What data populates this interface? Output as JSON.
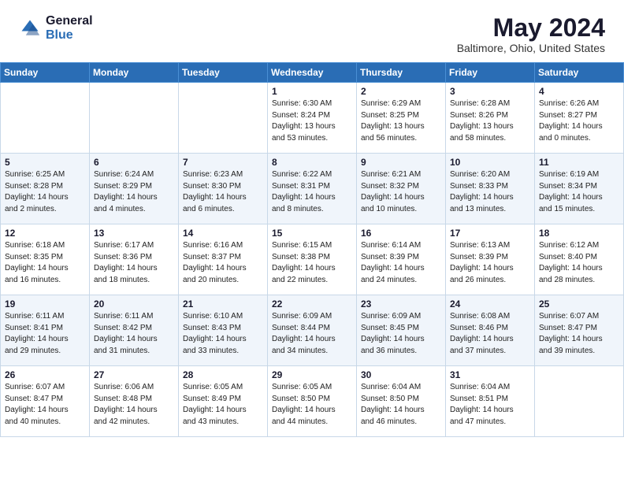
{
  "header": {
    "logo_general": "General",
    "logo_blue": "Blue",
    "main_title": "May 2024",
    "subtitle": "Baltimore, Ohio, United States"
  },
  "days_of_week": [
    "Sunday",
    "Monday",
    "Tuesday",
    "Wednesday",
    "Thursday",
    "Friday",
    "Saturday"
  ],
  "weeks": [
    [
      {
        "day": "",
        "info": ""
      },
      {
        "day": "",
        "info": ""
      },
      {
        "day": "",
        "info": ""
      },
      {
        "day": "1",
        "info": "Sunrise: 6:30 AM\nSunset: 8:24 PM\nDaylight: 13 hours\nand 53 minutes."
      },
      {
        "day": "2",
        "info": "Sunrise: 6:29 AM\nSunset: 8:25 PM\nDaylight: 13 hours\nand 56 minutes."
      },
      {
        "day": "3",
        "info": "Sunrise: 6:28 AM\nSunset: 8:26 PM\nDaylight: 13 hours\nand 58 minutes."
      },
      {
        "day": "4",
        "info": "Sunrise: 6:26 AM\nSunset: 8:27 PM\nDaylight: 14 hours\nand 0 minutes."
      }
    ],
    [
      {
        "day": "5",
        "info": "Sunrise: 6:25 AM\nSunset: 8:28 PM\nDaylight: 14 hours\nand 2 minutes."
      },
      {
        "day": "6",
        "info": "Sunrise: 6:24 AM\nSunset: 8:29 PM\nDaylight: 14 hours\nand 4 minutes."
      },
      {
        "day": "7",
        "info": "Sunrise: 6:23 AM\nSunset: 8:30 PM\nDaylight: 14 hours\nand 6 minutes."
      },
      {
        "day": "8",
        "info": "Sunrise: 6:22 AM\nSunset: 8:31 PM\nDaylight: 14 hours\nand 8 minutes."
      },
      {
        "day": "9",
        "info": "Sunrise: 6:21 AM\nSunset: 8:32 PM\nDaylight: 14 hours\nand 10 minutes."
      },
      {
        "day": "10",
        "info": "Sunrise: 6:20 AM\nSunset: 8:33 PM\nDaylight: 14 hours\nand 13 minutes."
      },
      {
        "day": "11",
        "info": "Sunrise: 6:19 AM\nSunset: 8:34 PM\nDaylight: 14 hours\nand 15 minutes."
      }
    ],
    [
      {
        "day": "12",
        "info": "Sunrise: 6:18 AM\nSunset: 8:35 PM\nDaylight: 14 hours\nand 16 minutes."
      },
      {
        "day": "13",
        "info": "Sunrise: 6:17 AM\nSunset: 8:36 PM\nDaylight: 14 hours\nand 18 minutes."
      },
      {
        "day": "14",
        "info": "Sunrise: 6:16 AM\nSunset: 8:37 PM\nDaylight: 14 hours\nand 20 minutes."
      },
      {
        "day": "15",
        "info": "Sunrise: 6:15 AM\nSunset: 8:38 PM\nDaylight: 14 hours\nand 22 minutes."
      },
      {
        "day": "16",
        "info": "Sunrise: 6:14 AM\nSunset: 8:39 PM\nDaylight: 14 hours\nand 24 minutes."
      },
      {
        "day": "17",
        "info": "Sunrise: 6:13 AM\nSunset: 8:39 PM\nDaylight: 14 hours\nand 26 minutes."
      },
      {
        "day": "18",
        "info": "Sunrise: 6:12 AM\nSunset: 8:40 PM\nDaylight: 14 hours\nand 28 minutes."
      }
    ],
    [
      {
        "day": "19",
        "info": "Sunrise: 6:11 AM\nSunset: 8:41 PM\nDaylight: 14 hours\nand 29 minutes."
      },
      {
        "day": "20",
        "info": "Sunrise: 6:11 AM\nSunset: 8:42 PM\nDaylight: 14 hours\nand 31 minutes."
      },
      {
        "day": "21",
        "info": "Sunrise: 6:10 AM\nSunset: 8:43 PM\nDaylight: 14 hours\nand 33 minutes."
      },
      {
        "day": "22",
        "info": "Sunrise: 6:09 AM\nSunset: 8:44 PM\nDaylight: 14 hours\nand 34 minutes."
      },
      {
        "day": "23",
        "info": "Sunrise: 6:09 AM\nSunset: 8:45 PM\nDaylight: 14 hours\nand 36 minutes."
      },
      {
        "day": "24",
        "info": "Sunrise: 6:08 AM\nSunset: 8:46 PM\nDaylight: 14 hours\nand 37 minutes."
      },
      {
        "day": "25",
        "info": "Sunrise: 6:07 AM\nSunset: 8:47 PM\nDaylight: 14 hours\nand 39 minutes."
      }
    ],
    [
      {
        "day": "26",
        "info": "Sunrise: 6:07 AM\nSunset: 8:47 PM\nDaylight: 14 hours\nand 40 minutes."
      },
      {
        "day": "27",
        "info": "Sunrise: 6:06 AM\nSunset: 8:48 PM\nDaylight: 14 hours\nand 42 minutes."
      },
      {
        "day": "28",
        "info": "Sunrise: 6:05 AM\nSunset: 8:49 PM\nDaylight: 14 hours\nand 43 minutes."
      },
      {
        "day": "29",
        "info": "Sunrise: 6:05 AM\nSunset: 8:50 PM\nDaylight: 14 hours\nand 44 minutes."
      },
      {
        "day": "30",
        "info": "Sunrise: 6:04 AM\nSunset: 8:50 PM\nDaylight: 14 hours\nand 46 minutes."
      },
      {
        "day": "31",
        "info": "Sunrise: 6:04 AM\nSunset: 8:51 PM\nDaylight: 14 hours\nand 47 minutes."
      },
      {
        "day": "",
        "info": ""
      }
    ]
  ]
}
